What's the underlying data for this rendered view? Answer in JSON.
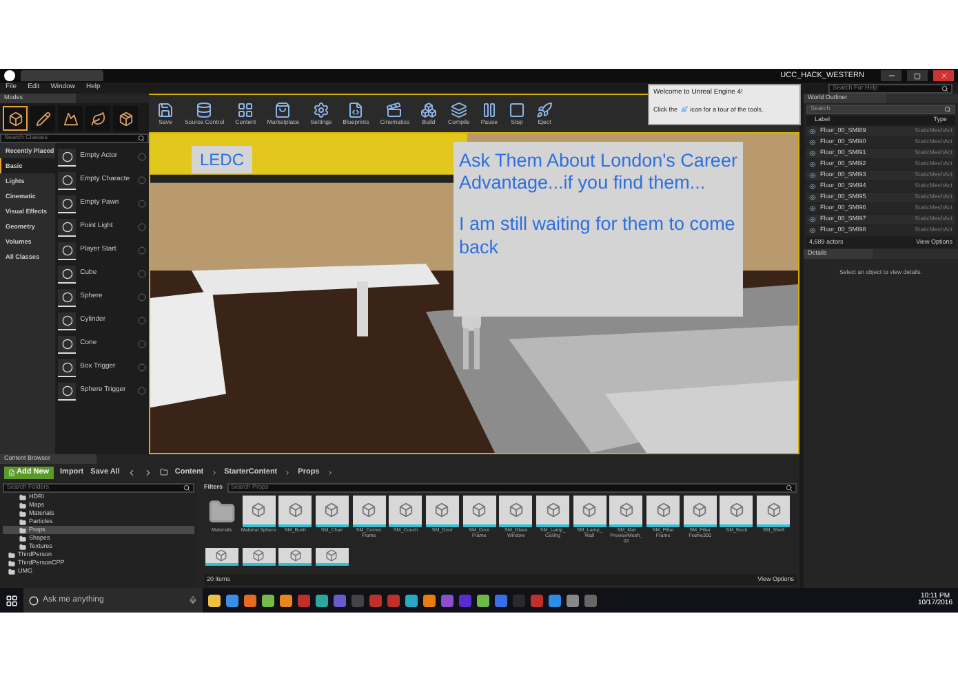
{
  "window": {
    "title": "UCC_HACK_WESTERN"
  },
  "menu": [
    "File",
    "Edit",
    "Window",
    "Help"
  ],
  "help_search": {
    "placeholder": "Search For Help"
  },
  "modes": {
    "tab": "Modes",
    "search": {
      "placeholder": "Search Classes"
    },
    "categories": [
      {
        "label": "Recently Placed",
        "selected": false
      },
      {
        "label": "Basic",
        "selected": true
      },
      {
        "label": "Lights",
        "selected": false
      },
      {
        "label": "Cinematic",
        "selected": false
      },
      {
        "label": "Visual Effects",
        "selected": false
      },
      {
        "label": "Geometry",
        "selected": false
      },
      {
        "label": "Volumes",
        "selected": false
      },
      {
        "label": "All Classes",
        "selected": false
      }
    ],
    "items": [
      "Empty Actor",
      "Empty Characte",
      "Empty Pawn",
      "Point Light",
      "Player Start",
      "Cube",
      "Sphere",
      "Cylinder",
      "Cone",
      "Box Trigger",
      "Sphere Trigger"
    ]
  },
  "toolbar": [
    {
      "label": "Save",
      "kind": "save"
    },
    {
      "label": "Source Control",
      "kind": "source"
    },
    {
      "label": "Content",
      "kind": "content"
    },
    {
      "label": "Marketplace",
      "kind": "market"
    },
    {
      "label": "Settings",
      "kind": "settings"
    },
    {
      "label": "Blueprints",
      "kind": "blueprints"
    },
    {
      "label": "Cinematics",
      "kind": "cinematics"
    },
    {
      "label": "Build",
      "kind": "build"
    },
    {
      "label": "Compile",
      "kind": "compile"
    },
    {
      "label": "Pause",
      "kind": "pause"
    },
    {
      "label": "Stop",
      "kind": "stop"
    },
    {
      "label": "Eject",
      "kind": "eject"
    }
  ],
  "notification": {
    "title": "Welcome to Unreal Engine 4!",
    "before": "Click the",
    "after": "icon for a tour of the tools."
  },
  "viewport": {
    "label": "LEDC",
    "message": [
      "Ask Them About London's Career Advantage...if you find them...",
      "I am still waiting for them to come back"
    ]
  },
  "outliner": {
    "tab": "World Outliner",
    "search": {
      "placeholder": "Search"
    },
    "columns": [
      "Label",
      "Type"
    ],
    "rows": [
      {
        "label": "Floor_00_SMI89",
        "type": "StaticMeshAct"
      },
      {
        "label": "Floor_00_SMI90",
        "type": "StaticMeshAct"
      },
      {
        "label": "Floor_00_SMI91",
        "type": "StaticMeshAct"
      },
      {
        "label": "Floor_00_SMI92",
        "type": "StaticMeshAct"
      },
      {
        "label": "Floor_00_SMI93",
        "type": "StaticMeshAct"
      },
      {
        "label": "Floor_00_SMI94",
        "type": "StaticMeshAct"
      },
      {
        "label": "Floor_00_SMI95",
        "type": "StaticMeshAct"
      },
      {
        "label": "Floor_00_SMI96",
        "type": "StaticMeshAct"
      },
      {
        "label": "Floor_00_SMI97",
        "type": "StaticMeshAct"
      },
      {
        "label": "Floor_00_SMI98",
        "type": "StaticMeshAct"
      }
    ],
    "count": "4,689 actors",
    "view_options": "View Options"
  },
  "details": {
    "tab": "Details",
    "hint": "Select an object to view details."
  },
  "content_browser": {
    "tab": "Content Browser",
    "add_new": "Add New",
    "import": "Import",
    "save_all": "Save All",
    "path": [
      "Content",
      "StarterContent",
      "Props"
    ],
    "folder_search": {
      "placeholder": "Search Folders"
    },
    "folders": [
      {
        "label": "HDRI",
        "selected": false
      },
      {
        "label": "Maps",
        "selected": false
      },
      {
        "label": "Materials",
        "selected": false
      },
      {
        "label": "Particles",
        "selected": false
      },
      {
        "label": "Props",
        "selected": true
      },
      {
        "label": "Shapes",
        "selected": false
      },
      {
        "label": "Textures",
        "selected": false
      },
      {
        "label": "ThirdPerson",
        "selected": false
      },
      {
        "label": "ThirdPersonCPP",
        "selected": false
      },
      {
        "label": "UMG",
        "selected": false
      }
    ],
    "filters": "Filters",
    "asset_search": {
      "placeholder": "Search Props"
    },
    "assets": [
      {
        "label": "Materials",
        "kind": "folder"
      },
      {
        "label": "Material Sphere",
        "kind": "asset"
      },
      {
        "label": "SM_Bush",
        "kind": "asset"
      },
      {
        "label": "SM_Chair",
        "kind": "asset"
      },
      {
        "label": "SM_Corner Frame",
        "kind": "asset"
      },
      {
        "label": "SM_Couch",
        "kind": "asset"
      },
      {
        "label": "SM_Door",
        "kind": "asset"
      },
      {
        "label": "SM_Door Frame",
        "kind": "asset"
      },
      {
        "label": "SM_Glass Window",
        "kind": "asset"
      },
      {
        "label": "SM_Lamp_ Ceiling",
        "kind": "asset"
      },
      {
        "label": "SM_Lamp_ Wall",
        "kind": "asset"
      },
      {
        "label": "SM_Mat PreviewMesh_ 02",
        "kind": "asset"
      },
      {
        "label": "SM_Pillar Frame",
        "kind": "asset"
      },
      {
        "label": "SM_Pillar Frame300",
        "kind": "asset"
      },
      {
        "label": "SM_Rock",
        "kind": "asset"
      },
      {
        "label": "SM_Shelf",
        "kind": "asset"
      }
    ],
    "count": "20 items",
    "view_options": "View Options"
  },
  "taskbar": {
    "search": {
      "placeholder": "Ask me anything"
    },
    "time": "10:11 PM",
    "date": "10/17/2016"
  }
}
